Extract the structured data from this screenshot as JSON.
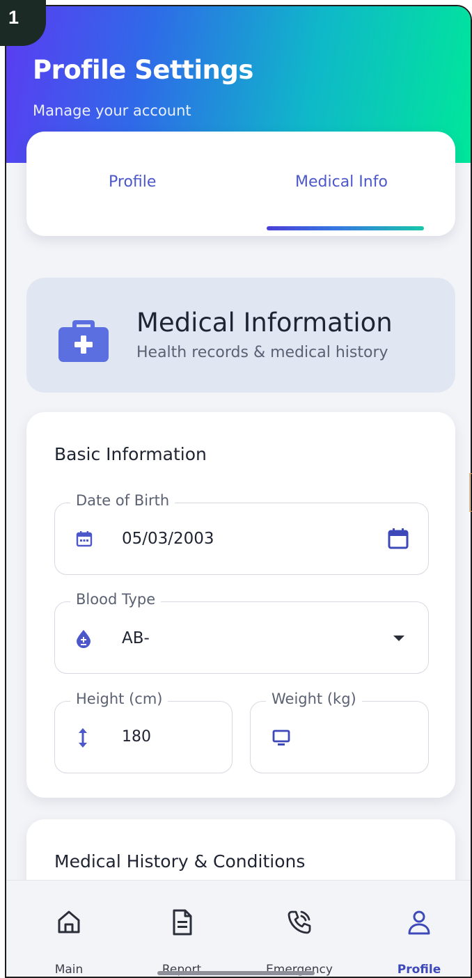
{
  "step_badge": "1",
  "header": {
    "title": "Profile Settings",
    "subtitle": "Manage your account"
  },
  "tabs": [
    {
      "label": "Profile",
      "active": false
    },
    {
      "label": "Medical Info",
      "active": true
    }
  ],
  "medical_card": {
    "title": "Medical Information",
    "subtitle": "Health records & medical history",
    "icon": "medical-kit-icon"
  },
  "basic_info": {
    "title": "Basic Information",
    "dob": {
      "label": "Date of Birth",
      "value": "05/03/2003",
      "icon": "calendar-icon",
      "trailing_icon": "calendar-picker-icon"
    },
    "blood_type": {
      "label": "Blood Type",
      "value": "AB-",
      "icon": "blood-drop-icon",
      "trailing_icon": "dropdown-arrow-icon"
    },
    "height": {
      "label": "Height (cm)",
      "value": "180",
      "icon": "height-arrows-icon"
    },
    "weight": {
      "label": "Weight (kg)",
      "value": "",
      "icon": "monitor-icon"
    }
  },
  "history": {
    "title": "Medical History & Conditions"
  },
  "nav": [
    {
      "label": "Main",
      "icon": "home-icon",
      "active": false
    },
    {
      "label": "Report",
      "icon": "document-icon",
      "active": false
    },
    {
      "label": "Emergency",
      "icon": "phone-call-icon",
      "active": false
    },
    {
      "label": "Profile",
      "icon": "user-icon",
      "active": true
    }
  ],
  "colors": {
    "accent": "#3d49b8",
    "gradient_start": "#5b3cf2",
    "gradient_end": "#00e79a",
    "medical_icon": "#5b6fe0"
  }
}
